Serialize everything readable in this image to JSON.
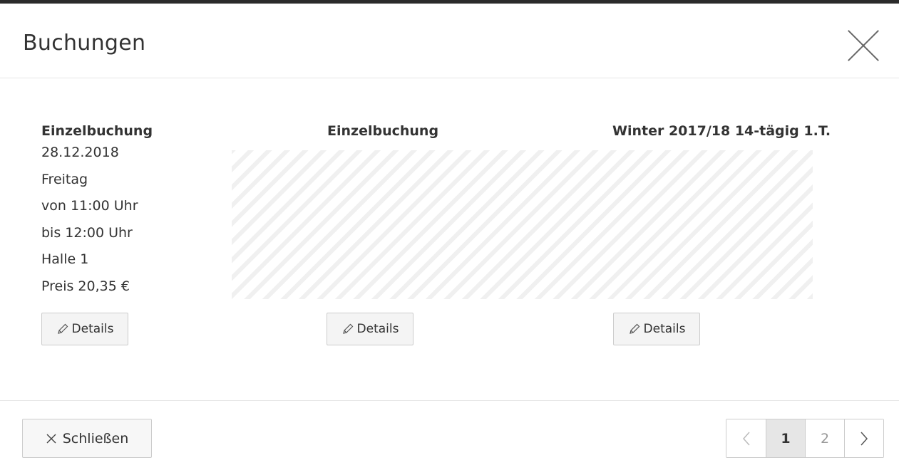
{
  "dialog": {
    "title": "Buchungen"
  },
  "bookings": [
    {
      "title": "Einzelbuchung",
      "lines": [
        "28.12.2018",
        "Freitag",
        "von 11:00 Uhr",
        "bis 12:00 Uhr",
        "Halle 1",
        "Preis 20,35 €"
      ],
      "details_label": "Details"
    },
    {
      "title": "Einzelbuchung",
      "lines": [],
      "details_label": "Details"
    },
    {
      "title": "Winter 2017/18 14-tägig 1.T.",
      "lines": [],
      "details_label": "Details"
    }
  ],
  "footer": {
    "close_label": "Schließen",
    "pagination": {
      "pages": [
        "1",
        "2"
      ],
      "current_page": "1"
    }
  },
  "icons": {
    "close": "close-icon",
    "pencil": "pencil-icon",
    "prev": "chevron-left-icon",
    "next": "chevron-right-icon"
  }
}
